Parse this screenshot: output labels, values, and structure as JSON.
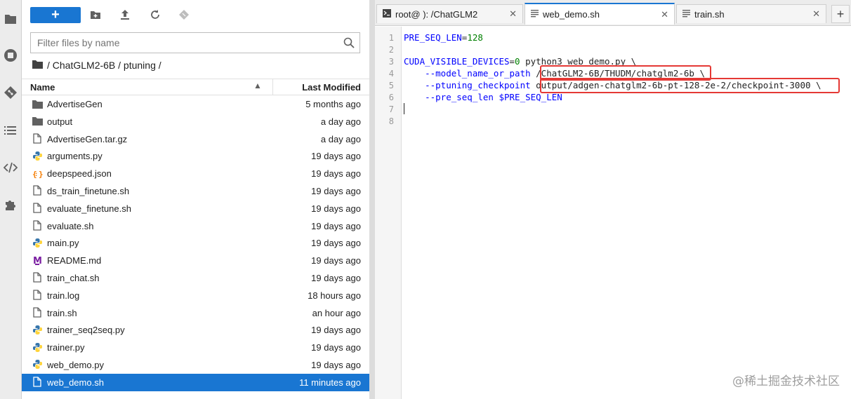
{
  "activity_bar": {
    "icons": [
      "folder-icon",
      "running-icon",
      "git-icon",
      "toc-icon",
      "code-icon",
      "extension-icon"
    ]
  },
  "file_browser": {
    "new_label": "+",
    "filter_placeholder": "Filter files by name",
    "breadcrumb": "/ ChatGLM2-6B / ptuning /",
    "columns": {
      "name": "Name",
      "modified": "Last Modified"
    },
    "files": [
      {
        "name": "AdvertiseGen",
        "modified": "5 months ago",
        "icon": "folder-icon"
      },
      {
        "name": "output",
        "modified": "a day ago",
        "icon": "folder-icon"
      },
      {
        "name": "AdvertiseGen.tar.gz",
        "modified": "a day ago",
        "icon": "file-icon"
      },
      {
        "name": "arguments.py",
        "modified": "19 days ago",
        "icon": "python-icon"
      },
      {
        "name": "deepspeed.json",
        "modified": "19 days ago",
        "icon": "json-icon"
      },
      {
        "name": "ds_train_finetune.sh",
        "modified": "19 days ago",
        "icon": "file-icon"
      },
      {
        "name": "evaluate_finetune.sh",
        "modified": "19 days ago",
        "icon": "file-icon"
      },
      {
        "name": "evaluate.sh",
        "modified": "19 days ago",
        "icon": "file-icon"
      },
      {
        "name": "main.py",
        "modified": "19 days ago",
        "icon": "python-icon"
      },
      {
        "name": "README.md",
        "modified": "19 days ago",
        "icon": "markdown-icon"
      },
      {
        "name": "train_chat.sh",
        "modified": "19 days ago",
        "icon": "file-icon"
      },
      {
        "name": "train.log",
        "modified": "18 hours ago",
        "icon": "file-icon"
      },
      {
        "name": "train.sh",
        "modified": "an hour ago",
        "icon": "file-icon"
      },
      {
        "name": "trainer_seq2seq.py",
        "modified": "19 days ago",
        "icon": "python-icon"
      },
      {
        "name": "trainer.py",
        "modified": "19 days ago",
        "icon": "python-icon"
      },
      {
        "name": "web_demo.py",
        "modified": "19 days ago",
        "icon": "python-icon"
      },
      {
        "name": "web_demo.sh",
        "modified": "11 minutes ago",
        "icon": "file-icon",
        "selected": true
      }
    ]
  },
  "editor": {
    "tabs": [
      {
        "label": "root@      ): /ChatGLM2",
        "icon": "terminal-icon",
        "active": false
      },
      {
        "label": "web_demo.sh",
        "icon": "text-file-icon",
        "active": true
      },
      {
        "label": "train.sh",
        "icon": "text-file-icon",
        "active": false
      }
    ],
    "add_tab_label": "+",
    "line_numbers": [
      "1",
      "2",
      "3",
      "4",
      "5",
      "6",
      "7",
      "8"
    ],
    "lines": {
      "l1_var": "PRE_SEQ_LEN",
      "l1_eq": "=",
      "l1_num": "128",
      "l3_var": "CUDA_VISIBLE_DEVICES",
      "l3_eq": "=",
      "l3_num": "0",
      "l3_rest": " python3 web_demo.py \\",
      "l4_flag": "    --model_name_or_path",
      "l4_val": "/ChatGLM2-6B/THUDM/chatglm2-6b",
      "l4_end": " \\",
      "l5_flag": "    --ptuning_checkpoint",
      "l5_val": "output/adgen-chatglm2-6b-pt-128-2e-2/checkpoint-3000 \\",
      "l6_flag": "    --pre_seq_len",
      "l6_var": " $PRE_SEQ_LEN"
    }
  },
  "watermark": "@稀土掘金技术社区"
}
